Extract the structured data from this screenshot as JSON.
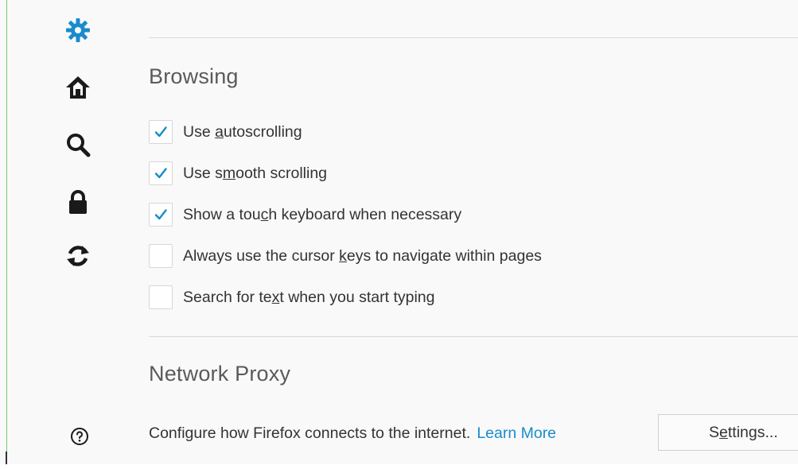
{
  "sidebar": {
    "icons": [
      {
        "name": "gear-icon",
        "color": "#1a8bcc",
        "selected": true
      },
      {
        "name": "home-icon",
        "color": "#1a1a1a"
      },
      {
        "name": "search-icon",
        "color": "#1a1a1a"
      },
      {
        "name": "lock-icon",
        "color": "#1a1a1a"
      },
      {
        "name": "sync-icon",
        "color": "#1a1a1a"
      }
    ],
    "help_icon": "help-circle-icon"
  },
  "browsing": {
    "title": "Browsing",
    "options": [
      {
        "before": "Use ",
        "key": "a",
        "after": "utoscrolling",
        "checked": true
      },
      {
        "before": "Use s",
        "key": "m",
        "after": "ooth scrolling",
        "checked": true
      },
      {
        "before": "Show a tou",
        "key": "c",
        "after": "h keyboard when necessary",
        "checked": true
      },
      {
        "before": "Always use the cursor ",
        "key": "k",
        "after": "eys to navigate within pages",
        "checked": false
      },
      {
        "before": "Search for te",
        "key": "x",
        "after": "t when you start typing",
        "checked": false
      }
    ]
  },
  "network_proxy": {
    "title": "Network Proxy",
    "description": "Configure how Firefox connects to the internet.",
    "learn_more": "Learn More",
    "settings_button": {
      "before": "S",
      "key": "e",
      "after": "ttings..."
    }
  },
  "colors": {
    "accent": "#1a8bcc",
    "checkmark": "#1a8bcc"
  }
}
